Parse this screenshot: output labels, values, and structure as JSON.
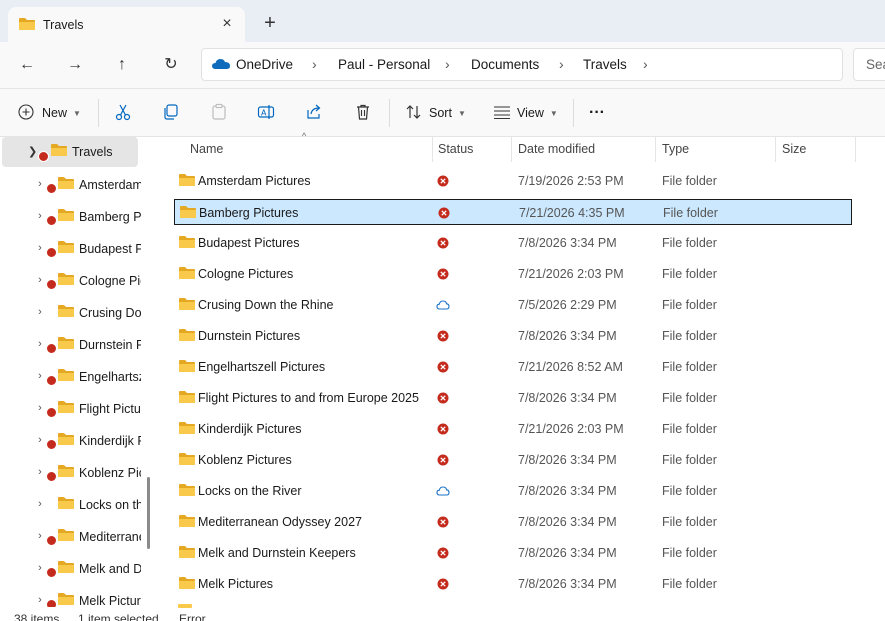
{
  "tab": {
    "title": "Travels",
    "close_icon": "×",
    "new_tab_icon": "+"
  },
  "nav": {
    "back_icon": "←",
    "forward_icon": "→",
    "up_icon": "↑",
    "refresh_icon": "↻"
  },
  "breadcrumb": [
    "OneDrive",
    "Paul - Personal",
    "Documents",
    "Travels"
  ],
  "search": {
    "placeholder": "Sea"
  },
  "toolbar": {
    "new_label": "New",
    "sort_label": "Sort",
    "view_label": "View",
    "more_label": "···"
  },
  "sidebar": {
    "selected": "Travels",
    "items": [
      {
        "label": "Amsterdam",
        "status": "error"
      },
      {
        "label": "Bamberg Pi",
        "status": "error"
      },
      {
        "label": "Budapest P",
        "status": "error"
      },
      {
        "label": "Cologne Pic",
        "status": "error"
      },
      {
        "label": "Crusing Dov",
        "status": "cloud"
      },
      {
        "label": "Durnstein P",
        "status": "error"
      },
      {
        "label": "Engelhartsz",
        "status": "error"
      },
      {
        "label": "Flight Pictu",
        "status": "error"
      },
      {
        "label": "Kinderdijk P",
        "status": "error"
      },
      {
        "label": "Koblenz Pic",
        "status": "error"
      },
      {
        "label": "Locks on th",
        "status": "cloud"
      },
      {
        "label": "Mediterrane",
        "status": "error"
      },
      {
        "label": "Melk and D",
        "status": "error"
      },
      {
        "label": "Melk Pictur",
        "status": "error"
      }
    ]
  },
  "columns": {
    "name": "Name",
    "status": "Status",
    "date": "Date modified",
    "type": "Type",
    "size": "Size"
  },
  "files": [
    {
      "name": "Amsterdam Pictures",
      "status": "error",
      "date": "7/19/2026 2:53 PM",
      "type": "File folder"
    },
    {
      "name": "Bamberg Pictures",
      "status": "error",
      "date": "7/21/2026 4:35 PM",
      "type": "File folder"
    },
    {
      "name": "Budapest Pictures",
      "status": "error",
      "date": "7/8/2026 3:34 PM",
      "type": "File folder"
    },
    {
      "name": "Cologne Pictures",
      "status": "error",
      "date": "7/21/2026 2:03 PM",
      "type": "File folder"
    },
    {
      "name": "Crusing Down the Rhine",
      "status": "cloud",
      "date": "7/5/2026 2:29 PM",
      "type": "File folder"
    },
    {
      "name": "Durnstein Pictures",
      "status": "error",
      "date": "7/8/2026 3:34 PM",
      "type": "File folder"
    },
    {
      "name": "Engelhartszell Pictures",
      "status": "error",
      "date": "7/21/2026 8:52 AM",
      "type": "File folder"
    },
    {
      "name": "Flight Pictures to and from Europe 2025",
      "status": "error",
      "date": "7/8/2026 3:34 PM",
      "type": "File folder"
    },
    {
      "name": "Kinderdijk Pictures",
      "status": "error",
      "date": "7/21/2026 2:03 PM",
      "type": "File folder"
    },
    {
      "name": "Koblenz Pictures",
      "status": "error",
      "date": "7/8/2026 3:34 PM",
      "type": "File folder"
    },
    {
      "name": "Locks on the River",
      "status": "cloud",
      "date": "7/8/2026 3:34 PM",
      "type": "File folder"
    },
    {
      "name": "Mediterranean Odyssey 2027",
      "status": "error",
      "date": "7/8/2026 3:34 PM",
      "type": "File folder"
    },
    {
      "name": "Melk and Durnstein Keepers",
      "status": "error",
      "date": "7/8/2026 3:34 PM",
      "type": "File folder"
    },
    {
      "name": "Melk Pictures",
      "status": "error",
      "date": "7/8/2026 3:34 PM",
      "type": "File folder"
    }
  ],
  "selected_file": "Bamberg Pictures",
  "statusbar": {
    "count": "38 items",
    "selected": "1 item selected",
    "state": "Error"
  },
  "colors": {
    "folder": "#f8c94a",
    "folder_dark": "#e5a823",
    "error": "#c42b1c",
    "cloud": "#1a73c8",
    "selection": "#cce8ff",
    "accent": "#0067c0"
  }
}
